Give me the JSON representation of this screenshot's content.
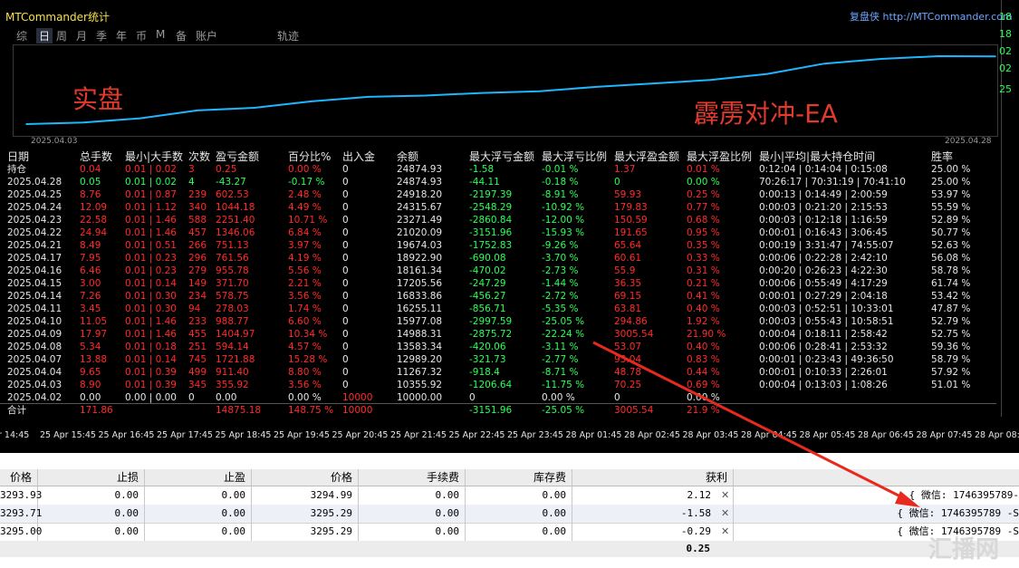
{
  "app": {
    "title": "MTCommander统计",
    "brand": "复盘侠 http://MTCommander.com"
  },
  "tabs": [
    "综",
    "日",
    "周",
    "月",
    "季",
    "年",
    "币",
    "M",
    "备",
    "账户",
    "轨迹"
  ],
  "active_tab": "日",
  "overlays": {
    "left_text": "实盘",
    "right_text": "霹雳对冲-EA"
  },
  "chart_dates": {
    "start": "2025.04.03",
    "end": "2025.04.28"
  },
  "chart_data": {
    "type": "line",
    "x": [
      "2025.04.03",
      "2025.04.04",
      "2025.04.07",
      "2025.04.08",
      "2025.04.09",
      "2025.04.10",
      "2025.04.11",
      "2025.04.14",
      "2025.04.15",
      "2025.04.16",
      "2025.04.17",
      "2025.04.21",
      "2025.04.22",
      "2025.04.23",
      "2025.04.24",
      "2025.04.25",
      "2025.04.28"
    ],
    "y": [
      10000,
      10355.92,
      11267.32,
      12989.2,
      13583.34,
      14988.31,
      15977.08,
      16255.11,
      16833.86,
      17205.56,
      18161.34,
      18922.9,
      19674.03,
      21020.09,
      23271.49,
      24315.67,
      24918.2,
      24874.93
    ],
    "line_color": "#1fb6ff",
    "grid": false
  },
  "columns": [
    "日期",
    "总手数",
    "最小|大手数",
    "次数",
    "盈亏金额",
    "百分比%",
    "出入金",
    "余额",
    "最大浮亏金额",
    "最大浮亏比例",
    "最大浮盈金额",
    "最大浮盈比例",
    "最小|平均|最大持仓时间",
    "胜率"
  ],
  "rows": [
    {
      "date": "持仓",
      "lots": "0.04",
      "minmax": "0.01 | 0.02",
      "count": "3",
      "pnl": "0.25",
      "pct": "0.00 %",
      "flow": "0",
      "bal": "24874.93",
      "mdd": "-1.58",
      "mddp": "-0.01 %",
      "mfe": "1.37",
      "mfep": "0.01 %",
      "hold": "0:12:04 | 0:14:04 | 0:15:08",
      "win": "25.00 %",
      "tone": "pos"
    },
    {
      "date": "2025.04.28",
      "lots": "0.05",
      "minmax": "0.01 | 0.02",
      "count": "4",
      "pnl": "-43.27",
      "pct": "-0.17 %",
      "flow": "0",
      "bal": "24874.93",
      "mdd": "-44.11",
      "mddp": "-0.18 %",
      "mfe": "0",
      "mfep": "0.00 %",
      "hold": "70:26:17 | 70:31:19 | 70:41:10",
      "win": "25.00 %",
      "tone": "neg"
    },
    {
      "date": "2025.04.25",
      "lots": "8.76",
      "minmax": "0.01 | 0.87",
      "count": "239",
      "pnl": "602.53",
      "pct": "2.48 %",
      "flow": "0",
      "bal": "24918.20",
      "mdd": "-2197.39",
      "mddp": "-8.91 %",
      "mfe": "59.93",
      "mfep": "0.25 %",
      "hold": "0:00:13 | 0:14:49 | 2:00:59",
      "win": "53.97 %",
      "tone": "pos"
    },
    {
      "date": "2025.04.24",
      "lots": "12.09",
      "minmax": "0.01 | 1.12",
      "count": "340",
      "pnl": "1044.18",
      "pct": "4.49 %",
      "flow": "0",
      "bal": "24315.67",
      "mdd": "-2548.29",
      "mddp": "-10.92 %",
      "mfe": "179.83",
      "mfep": "0.77 %",
      "hold": "0:00:03 | 0:21:20 | 2:15:53",
      "win": "55.59 %",
      "tone": "pos"
    },
    {
      "date": "2025.04.23",
      "lots": "22.58",
      "minmax": "0.01 | 1.46",
      "count": "588",
      "pnl": "2251.40",
      "pct": "10.71 %",
      "flow": "0",
      "bal": "23271.49",
      "mdd": "-2860.84",
      "mddp": "-12.00 %",
      "mfe": "150.59",
      "mfep": "0.68 %",
      "hold": "0:00:03 | 0:12:18 | 1:16:59",
      "win": "52.89 %",
      "tone": "pos"
    },
    {
      "date": "2025.04.22",
      "lots": "24.94",
      "minmax": "0.01 | 1.46",
      "count": "457",
      "pnl": "1346.06",
      "pct": "6.84 %",
      "flow": "0",
      "bal": "21020.09",
      "mdd": "-3151.96",
      "mddp": "-15.93 %",
      "mfe": "191.65",
      "mfep": "0.95 %",
      "hold": "0:00:01 | 0:16:43 | 3:06:45",
      "win": "50.77 %",
      "tone": "pos"
    },
    {
      "date": "2025.04.21",
      "lots": "8.49",
      "minmax": "0.01 | 0.51",
      "count": "266",
      "pnl": "751.13",
      "pct": "3.97 %",
      "flow": "0",
      "bal": "19674.03",
      "mdd": "-1752.83",
      "mddp": "-9.26 %",
      "mfe": "65.64",
      "mfep": "0.35 %",
      "hold": "0:00:19 | 3:31:47 | 74:55:07",
      "win": "52.63 %",
      "tone": "pos"
    },
    {
      "date": "2025.04.17",
      "lots": "7.95",
      "minmax": "0.01 | 0.23",
      "count": "296",
      "pnl": "761.56",
      "pct": "4.19 %",
      "flow": "0",
      "bal": "18922.90",
      "mdd": "-690.08",
      "mddp": "-3.70 %",
      "mfe": "60.61",
      "mfep": "0.33 %",
      "hold": "0:00:06 | 0:22:28 | 2:42:10",
      "win": "56.08 %",
      "tone": "pos"
    },
    {
      "date": "2025.04.16",
      "lots": "6.46",
      "minmax": "0.01 | 0.23",
      "count": "279",
      "pnl": "955.78",
      "pct": "5.56 %",
      "flow": "0",
      "bal": "18161.34",
      "mdd": "-470.02",
      "mddp": "-2.73 %",
      "mfe": "55.9",
      "mfep": "0.31 %",
      "hold": "0:00:20 | 0:26:23 | 4:22:30",
      "win": "58.78 %",
      "tone": "pos"
    },
    {
      "date": "2025.04.15",
      "lots": "3.00",
      "minmax": "0.01 | 0.14",
      "count": "149",
      "pnl": "371.70",
      "pct": "2.21 %",
      "flow": "0",
      "bal": "17205.56",
      "mdd": "-247.29",
      "mddp": "-1.44 %",
      "mfe": "36.35",
      "mfep": "0.21 %",
      "hold": "0:00:06 | 0:55:49 | 4:17:29",
      "win": "61.74 %",
      "tone": "pos"
    },
    {
      "date": "2025.04.14",
      "lots": "7.26",
      "minmax": "0.01 | 0.30",
      "count": "234",
      "pnl": "578.75",
      "pct": "3.56 %",
      "flow": "0",
      "bal": "16833.86",
      "mdd": "-456.27",
      "mddp": "-2.72 %",
      "mfe": "69.15",
      "mfep": "0.41 %",
      "hold": "0:00:01 | 0:27:29 | 2:04:18",
      "win": "53.42 %",
      "tone": "pos"
    },
    {
      "date": "2025.04.11",
      "lots": "3.45",
      "minmax": "0.01 | 0.30",
      "count": "94",
      "pnl": "278.03",
      "pct": "1.74 %",
      "flow": "0",
      "bal": "16255.11",
      "mdd": "-856.71",
      "mddp": "-5.35 %",
      "mfe": "63.81",
      "mfep": "0.40 %",
      "hold": "0:00:03 | 0:52:51 | 10:33:01",
      "win": "47.87 %",
      "tone": "pos"
    },
    {
      "date": "2025.04.10",
      "lots": "11.05",
      "minmax": "0.01 | 1.46",
      "count": "233",
      "pnl": "988.77",
      "pct": "6.60 %",
      "flow": "0",
      "bal": "15977.08",
      "mdd": "-2997.59",
      "mddp": "-25.05 %",
      "mfe": "294.86",
      "mfep": "1.92 %",
      "hold": "0:00:03 | 0:55:43 | 10:58:51",
      "win": "52.79 %",
      "tone": "pos"
    },
    {
      "date": "2025.04.09",
      "lots": "17.97",
      "minmax": "0.01 | 1.46",
      "count": "455",
      "pnl": "1404.97",
      "pct": "10.34 %",
      "flow": "0",
      "bal": "14988.31",
      "mdd": "-2875.72",
      "mddp": "-22.24 %",
      "mfe": "3005.54",
      "mfep": "21.90 %",
      "hold": "0:00:04 | 0:18:11 | 2:58:42",
      "win": "52.75 %",
      "tone": "pos"
    },
    {
      "date": "2025.04.08",
      "lots": "5.34",
      "minmax": "0.01 | 0.18",
      "count": "251",
      "pnl": "594.14",
      "pct": "4.57 %",
      "flow": "0",
      "bal": "13583.34",
      "mdd": "-420.06",
      "mddp": "-3.11 %",
      "mfe": "53.07",
      "mfep": "0.40 %",
      "hold": "0:00:06 | 0:28:41 | 2:53:32",
      "win": "59.36 %",
      "tone": "pos"
    },
    {
      "date": "2025.04.07",
      "lots": "13.88",
      "minmax": "0.01 | 0.14",
      "count": "745",
      "pnl": "1721.88",
      "pct": "15.28 %",
      "flow": "0",
      "bal": "12989.20",
      "mdd": "-321.73",
      "mddp": "-2.77 %",
      "mfe": "93.04",
      "mfep": "0.83 %",
      "hold": "0:00:01 | 0:23:43 | 49:36:50",
      "win": "58.79 %",
      "tone": "pos"
    },
    {
      "date": "2025.04.04",
      "lots": "9.65",
      "minmax": "0.01 | 0.39",
      "count": "499",
      "pnl": "911.40",
      "pct": "8.80 %",
      "flow": "0",
      "bal": "11267.32",
      "mdd": "-918.4",
      "mddp": "-8.71 %",
      "mfe": "48.78",
      "mfep": "0.44 %",
      "hold": "0:00:01 | 0:10:33 | 2:26:01",
      "win": "57.92 %",
      "tone": "pos"
    },
    {
      "date": "2025.04.03",
      "lots": "8.90",
      "minmax": "0.01 | 0.39",
      "count": "345",
      "pnl": "355.92",
      "pct": "3.56 %",
      "flow": "0",
      "bal": "10355.92",
      "mdd": "-1206.64",
      "mddp": "-11.75 %",
      "mfe": "70.25",
      "mfep": "0.69 %",
      "hold": "0:00:04 | 0:13:03 | 1:08:26",
      "win": "51.01 %",
      "tone": "pos"
    },
    {
      "date": "2025.04.02",
      "lots": "0.00",
      "minmax": "0.00 | 0.00",
      "count": "0",
      "pnl": "0.00",
      "pct": "0.00 %",
      "flow": "10000",
      "bal": "10000.00",
      "mdd": "0",
      "mddp": "0.00 %",
      "mfe": "0",
      "mfep": "0.00 %",
      "hold": "",
      "win": "",
      "tone": "zero"
    }
  ],
  "total": {
    "label": "合计",
    "lots": "171.86",
    "pnl": "14875.18",
    "pct": "148.75 %",
    "flow": "10000",
    "mdd": "-3151.96",
    "mddp": "-25.05 %",
    "mfe": "3005.54",
    "mfep": "21.9 %"
  },
  "right_axis": [
    "18",
    "18",
    "02",
    "02",
    "25"
  ],
  "time_axis": [
    "r 14:45",
    "25 Apr 15:45",
    "25 Apr 16:45",
    "25 Apr 17:45",
    "25 Apr 18:45",
    "25 Apr 19:45",
    "25 Apr 20:45",
    "25 Apr 21:45",
    "25 Apr 22:45",
    "25 Apr 23:45",
    "28 Apr 01:45",
    "28 Apr 02:45",
    "28 Apr 03:45",
    "28 Apr 04:45",
    "28 Apr 05:45",
    "28 Apr 06:45",
    "28 Apr 07:45",
    "28 Apr 08:45"
  ],
  "grid": {
    "headers": [
      "价格",
      "止损",
      "止盈",
      "价格",
      "手续费",
      "库存费",
      "获利"
    ],
    "rows": [
      {
        "price": "3293.93",
        "sl": "0.00",
        "tp": "0.00",
        "cur": "3294.99",
        "fee": "0.00",
        "swap": "0.00",
        "profit": "2.12",
        "comment": "{ 微信: 1746395789-"
      },
      {
        "price": "3293.71",
        "sl": "0.00",
        "tp": "0.00",
        "cur": "3295.29",
        "fee": "0.00",
        "swap": "0.00",
        "profit": "-1.58",
        "comment": "{ 微信: 1746395789 -S"
      },
      {
        "price": "3295.00",
        "sl": "0.00",
        "tp": "0.00",
        "cur": "3295.29",
        "fee": "0.00",
        "swap": "0.00",
        "profit": "-0.29",
        "comment": "{ 微信: 1746395789 -S"
      }
    ],
    "total_profit": "0.25"
  },
  "watermark": "汇播网",
  "colors": {
    "pos": "#ff2b2b",
    "neg": "#2bff58",
    "zero": "#e6e6e6",
    "accent": "#f4e04c",
    "curve": "#1fb6ff",
    "annotation_arrow": "#e8291e"
  }
}
